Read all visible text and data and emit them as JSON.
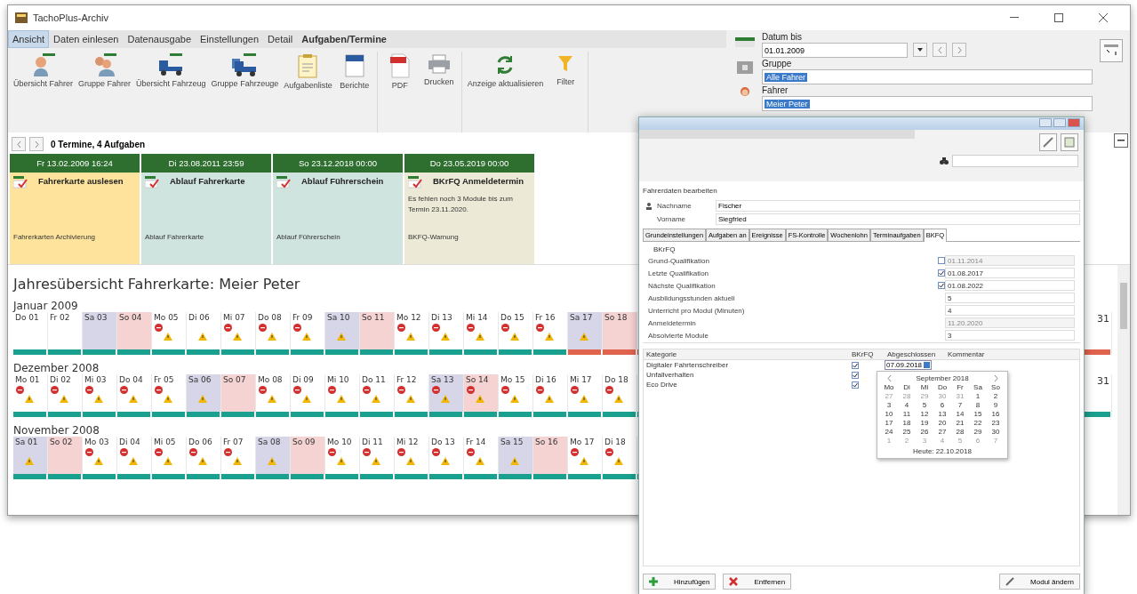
{
  "window": {
    "title": "TachoPlus-Archiv"
  },
  "menu_tabs": [
    {
      "label": "Ansicht",
      "selected": true,
      "kind": "normal"
    },
    {
      "label": "Daten einlesen",
      "selected": false,
      "kind": "normal"
    },
    {
      "label": "Datenausgabe",
      "selected": false,
      "kind": "normal"
    },
    {
      "label": "Einstellungen",
      "selected": false,
      "kind": "normal"
    },
    {
      "label": "Detail",
      "selected": false,
      "kind": "normal"
    },
    {
      "label": "Aufgaben/Termine",
      "selected": false,
      "kind": "context"
    }
  ],
  "ribbon_groups": [
    [
      {
        "label": "Übersicht Fahrer",
        "kind": "person"
      },
      {
        "label": "Gruppe Fahrer",
        "kind": "people"
      },
      {
        "label": "Übersicht Fahrzeug",
        "kind": "truck"
      },
      {
        "label": "Gruppe Fahrzeuge",
        "kind": "trucks"
      },
      {
        "label": "Aufgabenliste",
        "kind": "clipboard"
      },
      {
        "label": "Berichte",
        "kind": "report"
      }
    ],
    [
      {
        "label": "PDF",
        "kind": "pdf"
      },
      {
        "label": "Drucken",
        "kind": "printer"
      }
    ],
    [
      {
        "label": "Anzeige aktualisieren",
        "kind": "refresh"
      },
      {
        "label": "Filter",
        "kind": "filter"
      }
    ]
  ],
  "filters": {
    "date_label": "Datum bis",
    "date_value": "01.01.2009",
    "group_label": "Gruppe",
    "group_value": "Alle Fahrer",
    "driver_label": "Fahrer",
    "driver_value": "Meier Peter"
  },
  "tasks": {
    "summary": "0 Termine, 4 Aufgaben",
    "cards": [
      {
        "date": "Fr 13.02.2009 16:24",
        "title": "Fahrerkarte auslesen",
        "footer": "Fahrerkarten Archivierung",
        "color": "#fde39c"
      },
      {
        "date": "Di 23.08.2011 23:59",
        "title": "Ablauf Fahrerkarte",
        "footer": "Ablauf Fahrerkarte",
        "color": "#cfe3df"
      },
      {
        "date": "So 23.12.2018 00:00",
        "title": "Ablauf Führerschein",
        "footer": "Ablauf Führerschein",
        "color": "#cfe3df"
      },
      {
        "date": "Do 23.05.2019 00:00",
        "title": "BKrFQ Anmeldetermin",
        "text": "Es fehlen noch 3 Module bis zum Termin 23.11.2020.",
        "footer": "BKFQ-Warnung",
        "color": "#ecead6"
      }
    ]
  },
  "year_overview": {
    "title": "Jahresübersicht Fahrerkarte: Meier Peter",
    "months": [
      {
        "name": "Januar 2009",
        "days": [
          {
            "label": "Do 01",
            "kind": "weekday",
            "error": false,
            "warning": false,
            "alert": false
          },
          {
            "label": "Fr 02",
            "kind": "weekday",
            "error": false,
            "warning": false,
            "alert": false
          },
          {
            "label": "Sa 03",
            "kind": "saturday",
            "error": false,
            "warning": false,
            "alert": false
          },
          {
            "label": "So 04",
            "kind": "sunday",
            "error": false,
            "warning": false,
            "alert": false
          },
          {
            "label": "Mo 05",
            "kind": "weekday",
            "error": true,
            "warning": true,
            "alert": false
          },
          {
            "label": "Di 06",
            "kind": "weekday",
            "error": false,
            "warning": true,
            "alert": false
          },
          {
            "label": "Mi 07",
            "kind": "weekday",
            "error": true,
            "warning": true,
            "alert": false
          },
          {
            "label": "Do 08",
            "kind": "weekday",
            "error": true,
            "warning": true,
            "alert": false
          },
          {
            "label": "Fr 09",
            "kind": "weekday",
            "error": true,
            "warning": true,
            "alert": false
          },
          {
            "label": "Sa 10",
            "kind": "saturday",
            "error": false,
            "warning": true,
            "alert": false
          },
          {
            "label": "So 11",
            "kind": "sunday",
            "error": false,
            "warning": false,
            "alert": false
          },
          {
            "label": "Mo 12",
            "kind": "weekday",
            "error": true,
            "warning": true,
            "alert": false
          },
          {
            "label": "Di 13",
            "kind": "weekday",
            "error": true,
            "warning": true,
            "alert": false
          },
          {
            "label": "Mi 14",
            "kind": "weekday",
            "error": true,
            "warning": true,
            "alert": false
          },
          {
            "label": "Do 15",
            "kind": "weekday",
            "error": true,
            "warning": true,
            "alert": false
          },
          {
            "label": "Fr 16",
            "kind": "weekday",
            "error": true,
            "warning": true,
            "alert": false
          },
          {
            "label": "Sa 17",
            "kind": "saturday",
            "error": false,
            "warning": true,
            "alert": true
          },
          {
            "label": "So 18",
            "kind": "sunday",
            "error": false,
            "warning": false,
            "alert": true
          }
        ],
        "last_day": {
          "label": "31",
          "alert": true
        }
      },
      {
        "name": "Dezember 2008",
        "days": [
          {
            "label": "Mo 01",
            "kind": "weekday",
            "error": true,
            "warning": true,
            "alert": false
          },
          {
            "label": "Di 02",
            "kind": "weekday",
            "error": true,
            "warning": true,
            "alert": false
          },
          {
            "label": "Mi 03",
            "kind": "weekday",
            "error": true,
            "warning": true,
            "alert": false
          },
          {
            "label": "Do 04",
            "kind": "weekday",
            "error": true,
            "warning": true,
            "alert": false
          },
          {
            "label": "Fr 05",
            "kind": "weekday",
            "error": true,
            "warning": true,
            "alert": false
          },
          {
            "label": "Sa 06",
            "kind": "saturday",
            "error": false,
            "warning": true,
            "alert": false
          },
          {
            "label": "So 07",
            "kind": "sunday",
            "error": false,
            "warning": false,
            "alert": false
          },
          {
            "label": "Mo 08",
            "kind": "weekday",
            "error": true,
            "warning": true,
            "alert": false
          },
          {
            "label": "Di 09",
            "kind": "weekday",
            "error": true,
            "warning": true,
            "alert": false
          },
          {
            "label": "Mi 10",
            "kind": "weekday",
            "error": true,
            "warning": true,
            "alert": false
          },
          {
            "label": "Do 11",
            "kind": "weekday",
            "error": true,
            "warning": true,
            "alert": false
          },
          {
            "label": "Fr 12",
            "kind": "weekday",
            "error": true,
            "warning": true,
            "alert": false
          },
          {
            "label": "Sa 13",
            "kind": "saturday",
            "error": true,
            "warning": true,
            "alert": false
          },
          {
            "label": "So 14",
            "kind": "sunday",
            "error": true,
            "warning": true,
            "alert": false
          },
          {
            "label": "Mo 15",
            "kind": "weekday",
            "error": true,
            "warning": true,
            "alert": false
          },
          {
            "label": "Di 16",
            "kind": "weekday",
            "error": true,
            "warning": true,
            "alert": false
          },
          {
            "label": "Mi 17",
            "kind": "weekday",
            "error": true,
            "warning": true,
            "alert": false
          },
          {
            "label": "Do 18",
            "kind": "weekday",
            "error": true,
            "warning": true,
            "alert": false
          }
        ],
        "last_day": {
          "label": "31",
          "alert": false
        }
      },
      {
        "name": "November 2008",
        "days": [
          {
            "label": "Sa 01",
            "kind": "saturday",
            "error": false,
            "warning": true,
            "alert": false
          },
          {
            "label": "So 02",
            "kind": "sunday",
            "error": false,
            "warning": false,
            "alert": false
          },
          {
            "label": "Mo 03",
            "kind": "weekday",
            "error": true,
            "warning": true,
            "alert": false
          },
          {
            "label": "Di 04",
            "kind": "weekday",
            "error": true,
            "warning": true,
            "alert": false
          },
          {
            "label": "Mi 05",
            "kind": "weekday",
            "error": true,
            "warning": true,
            "alert": false
          },
          {
            "label": "Do 06",
            "kind": "weekday",
            "error": true,
            "warning": true,
            "alert": false
          },
          {
            "label": "Fr 07",
            "kind": "weekday",
            "error": true,
            "warning": true,
            "alert": false
          },
          {
            "label": "Sa 08",
            "kind": "saturday",
            "error": false,
            "warning": true,
            "alert": false
          },
          {
            "label": "So 09",
            "kind": "sunday",
            "error": false,
            "warning": false,
            "alert": false
          },
          {
            "label": "Mo 10",
            "kind": "weekday",
            "error": true,
            "warning": true,
            "alert": false
          },
          {
            "label": "Di 11",
            "kind": "weekday",
            "error": true,
            "warning": true,
            "alert": false
          },
          {
            "label": "Mi 12",
            "kind": "weekday",
            "error": true,
            "warning": true,
            "alert": false
          },
          {
            "label": "Do 13",
            "kind": "weekday",
            "error": true,
            "warning": true,
            "alert": false
          },
          {
            "label": "Fr 14",
            "kind": "weekday",
            "error": true,
            "warning": true,
            "alert": false
          },
          {
            "label": "Sa 15",
            "kind": "saturday",
            "error": false,
            "warning": true,
            "alert": false
          },
          {
            "label": "So 16",
            "kind": "sunday",
            "error": false,
            "warning": false,
            "alert": false
          },
          {
            "label": "Mo 17",
            "kind": "weekday",
            "error": true,
            "warning": true,
            "alert": false
          },
          {
            "label": "Di 18",
            "kind": "weekday",
            "error": true,
            "warning": true,
            "alert": false
          }
        ]
      }
    ]
  },
  "dialog": {
    "heading": "Fahrerdaten bearbeiten",
    "name_fields": [
      {
        "label": "Nachname",
        "value": "Fischer"
      },
      {
        "label": "Vorname",
        "value": "Siegfried"
      }
    ],
    "tabs": [
      {
        "label": "Grundeinstellungen",
        "selected": false
      },
      {
        "label": "Aufgaben an",
        "selected": false
      },
      {
        "label": "Ereignisse",
        "selected": false
      },
      {
        "label": "FS-Kontrolle",
        "selected": false
      },
      {
        "label": "Wochenlohn",
        "selected": false
      },
      {
        "label": "Terminaufgaben",
        "selected": false
      },
      {
        "label": "BKFQ",
        "selected": true
      }
    ],
    "group_title": "BKrFQ",
    "fields": [
      {
        "label": "Grund-Qualifikation",
        "value": "01.11.2014",
        "kind": "date",
        "checked": false
      },
      {
        "label": "Letzte Qualifikation",
        "value": "01.08.2017",
        "kind": "date",
        "checked": true
      },
      {
        "label": "Nächste Qualifikation",
        "value": "01.08.2022",
        "kind": "date",
        "checked": true
      },
      {
        "label": "Ausbildungsstunden aktuell",
        "value": "5",
        "kind": "number"
      },
      {
        "label": "Unterricht pro Modul (Minuten)",
        "value": "4",
        "kind": "number"
      },
      {
        "label": "Anmeldetermin",
        "value": "11.20.2020",
        "kind": "readonly"
      },
      {
        "label": "Absolvierte Module",
        "value": "3",
        "kind": "plain"
      }
    ],
    "table": {
      "columns": [
        "Kategorie",
        "BKrFQ",
        "Abgeschlossen",
        "Kommentar"
      ],
      "rows": [
        {
          "name": "Digitaler Fahrtenschreiber",
          "checked": true,
          "date": "07.09.2018"
        },
        {
          "name": "Unfallverhalten",
          "checked": true
        },
        {
          "name": "Eco Drive",
          "checked": true
        }
      ]
    },
    "date_picker": {
      "month": "September 2018",
      "weekdays": [
        "Mo",
        "Di",
        "Mi",
        "Do",
        "Fr",
        "Sa",
        "So"
      ],
      "days": [
        {
          "label": "27",
          "outside": true
        },
        {
          "label": "28",
          "outside": true
        },
        {
          "label": "29",
          "outside": true
        },
        {
          "label": "30",
          "outside": true
        },
        {
          "label": "31",
          "outside": true
        },
        {
          "label": "1",
          "outside": false
        },
        {
          "label": "2",
          "outside": false
        },
        {
          "label": "3",
          "outside": false
        },
        {
          "label": "4",
          "outside": false
        },
        {
          "label": "5",
          "outside": false
        },
        {
          "label": "6",
          "outside": false
        },
        {
          "label": "7",
          "outside": false
        },
        {
          "label": "8",
          "outside": false
        },
        {
          "label": "9",
          "outside": false
        },
        {
          "label": "10",
          "outside": false
        },
        {
          "label": "11",
          "outside": false
        },
        {
          "label": "12",
          "outside": false
        },
        {
          "label": "13",
          "outside": false
        },
        {
          "label": "14",
          "outside": false
        },
        {
          "label": "15",
          "outside": false
        },
        {
          "label": "16",
          "outside": false
        },
        {
          "label": "17",
          "outside": false
        },
        {
          "label": "18",
          "outside": false
        },
        {
          "label": "19",
          "outside": false
        },
        {
          "label": "20",
          "outside": false
        },
        {
          "label": "21",
          "outside": false
        },
        {
          "label": "22",
          "outside": false
        },
        {
          "label": "23",
          "outside": false
        },
        {
          "label": "24",
          "outside": false
        },
        {
          "label": "25",
          "outside": false
        },
        {
          "label": "26",
          "outside": false
        },
        {
          "label": "27",
          "outside": false
        },
        {
          "label": "28",
          "outside": false
        },
        {
          "label": "29",
          "outside": false
        },
        {
          "label": "30",
          "outside": false
        },
        {
          "label": "1",
          "outside": true
        },
        {
          "label": "2",
          "outside": true
        },
        {
          "label": "3",
          "outside": true
        },
        {
          "label": "4",
          "outside": true
        },
        {
          "label": "5",
          "outside": true
        },
        {
          "label": "6",
          "outside": true
        },
        {
          "label": "7",
          "outside": true
        }
      ],
      "today": "Heute: 22.10.2018"
    },
    "buttons": [
      {
        "label": "Hinzufügen",
        "kind": "add"
      },
      {
        "label": "Entfernen",
        "kind": "remove"
      },
      {
        "label": "Modul ändern",
        "kind": "edit"
      }
    ]
  }
}
